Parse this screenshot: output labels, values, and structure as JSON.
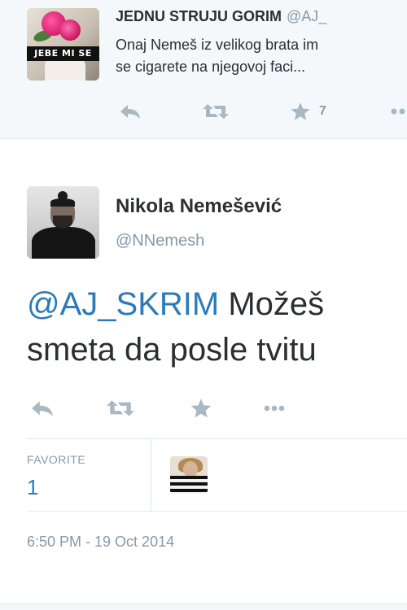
{
  "prev_tweet": {
    "avatar_caption": "JEBE MI SE",
    "name": "JEDNU STRUJU GORIM",
    "handle": "@AJ_",
    "text_line1": "Onaj Nemeš iz velikog brata im",
    "text_line2": "se cigarete na njegovoj faci...",
    "favorite_count": "7",
    "icons": [
      "reply-icon",
      "retweet-icon",
      "favorite-icon",
      "more-icon"
    ]
  },
  "main_tweet": {
    "name": "Nikola Nemešević",
    "handle": "@NNemesh",
    "mention": "@AJ_SKRIM",
    "text_rest_line1": " Možeš",
    "text_line2": "smeta da posle tvitu",
    "stats": {
      "favorites_label": "FAVORITE",
      "favorites_value": "1"
    },
    "timestamp": "6:50 PM - 19 Oct 2014",
    "icons": [
      "reply-icon",
      "retweet-icon",
      "favorite-icon",
      "more-icon"
    ]
  },
  "colors": {
    "link": "#2b7bb9",
    "text": "#292f33",
    "muted": "#8899a6",
    "icon": "#aab8c2",
    "border": "#e1e8ed",
    "header_bg": "#f5f8fa"
  }
}
